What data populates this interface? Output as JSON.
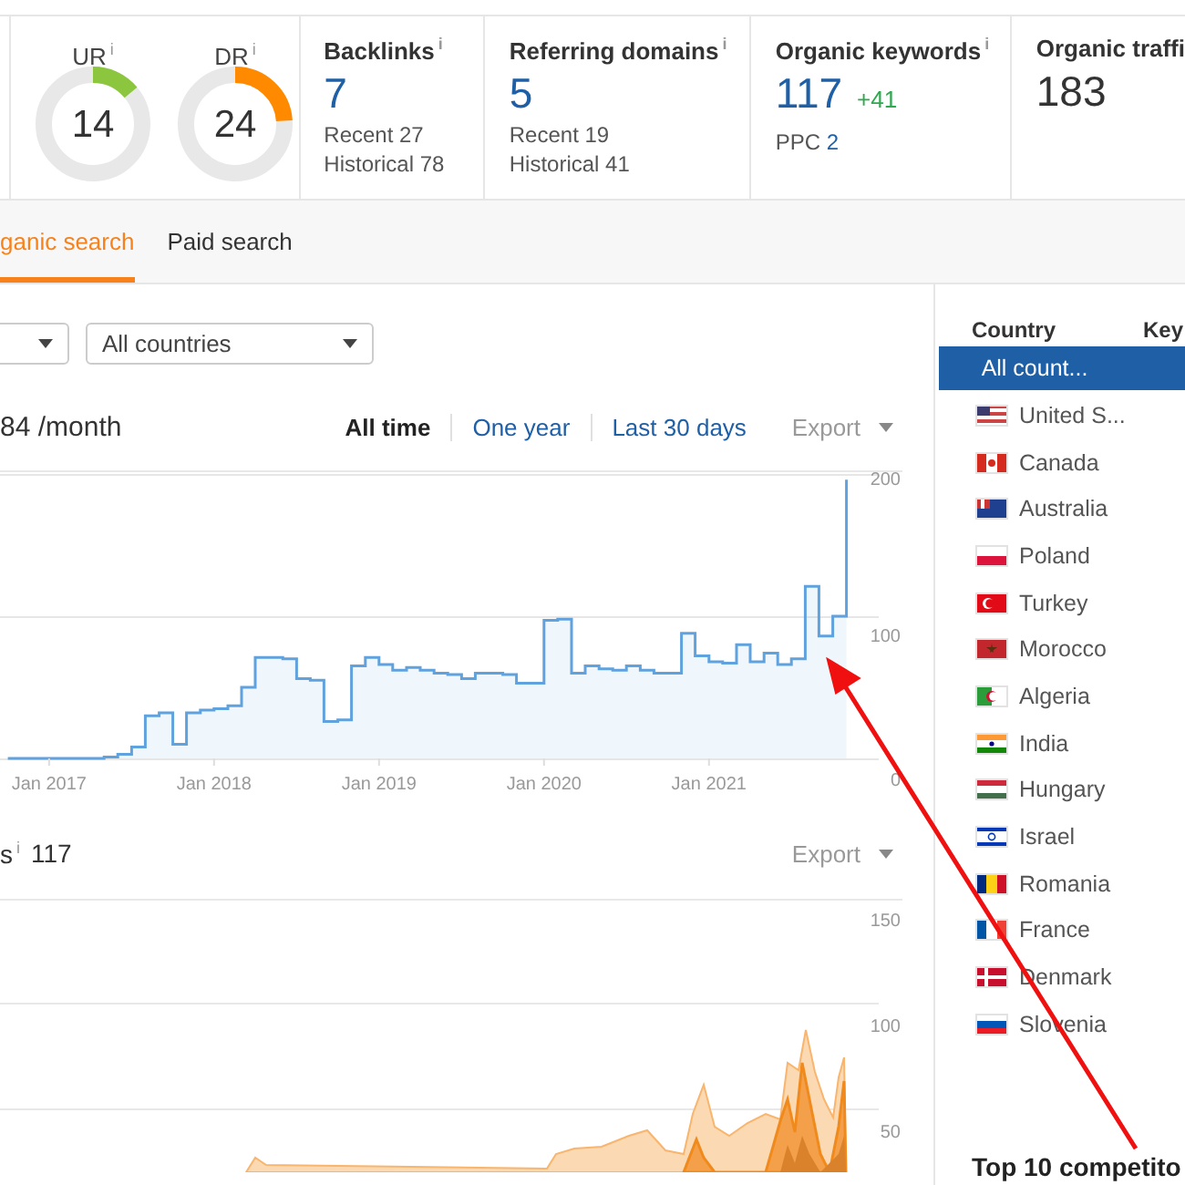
{
  "gauges": [
    {
      "label": "UR",
      "info": "i",
      "value": "14",
      "level": 0.14,
      "color": "#8cc63f"
    },
    {
      "label": "DR",
      "info": "i",
      "value": "24",
      "level": 0.24,
      "color": "#ff8a00"
    }
  ],
  "metrics": [
    {
      "label": "Backlinks",
      "info": "i",
      "value": "7",
      "kind": "link",
      "lines": [
        {
          "kind": "plain",
          "text": "Recent 27"
        },
        {
          "kind": "plain",
          "text": "Historical 78"
        }
      ]
    },
    {
      "label": "Referring domains",
      "info": "i",
      "value": "5",
      "kind": "link",
      "lines": [
        {
          "kind": "plain",
          "text": "Recent 19"
        },
        {
          "kind": "plain",
          "text": "Historical 41"
        }
      ]
    },
    {
      "label": "Organic keywords",
      "info": "i",
      "value": "117",
      "kind": "link",
      "change": "+41",
      "lines": [
        {
          "kind": "link",
          "label": "PPC",
          "value": "2"
        }
      ]
    },
    {
      "label": "Organic traffi",
      "value": "183",
      "kind": "plain"
    }
  ],
  "tabs": [
    {
      "label": "ganic search",
      "selected": true
    },
    {
      "label": "Paid search",
      "selected": false
    }
  ],
  "filters": [
    {
      "kind": "dropdown"
    },
    {
      "kind": "dropdown",
      "value": "All countries"
    }
  ],
  "traffic_summary": "84 /month",
  "time_ranges": [
    {
      "label": "All time",
      "selected": true
    },
    {
      "label": "One year",
      "selected": false
    },
    {
      "label": "Last 30 days",
      "selected": false
    }
  ],
  "traffic_chart": {
    "export": "Export",
    "chart_data": {
      "type": "area",
      "ylim": [
        0,
        200
      ],
      "yticks": [
        0,
        100,
        200
      ],
      "categories": [
        null,
        null,
        null,
        "Jan 2017",
        null,
        null,
        null,
        null,
        null,
        null,
        null,
        null,
        null,
        null,
        null,
        "Jan 2018",
        null,
        null,
        null,
        null,
        null,
        null,
        null,
        null,
        null,
        null,
        null,
        "Jan 2019",
        null,
        null,
        null,
        null,
        null,
        null,
        null,
        null,
        null,
        null,
        null,
        "Jan 2020",
        null,
        null,
        null,
        null,
        null,
        null,
        null,
        null,
        null,
        null,
        null,
        "Jan 2021",
        null,
        null,
        null,
        null,
        null,
        null,
        null,
        null,
        null,
        null
      ],
      "series": [
        {
          "color": "#5fa2dd",
          "values": [
            0,
            0,
            0,
            0,
            0,
            0,
            0,
            1,
            3,
            8,
            30,
            32,
            10,
            32,
            34,
            35,
            37,
            50,
            71,
            71,
            70,
            56,
            55,
            26,
            27,
            65,
            71,
            66,
            62,
            64,
            62,
            60,
            59,
            56,
            60,
            60,
            59,
            53,
            53,
            97,
            98,
            60,
            65,
            63,
            62,
            65,
            62,
            60,
            60,
            88,
            72,
            68,
            67,
            80,
            68,
            74,
            66,
            70,
            121,
            86,
            100,
            196
          ]
        }
      ]
    }
  },
  "keywords_chart": {
    "title": "s",
    "info": "i",
    "count": "117",
    "export": "Export",
    "y_axis_labels": [
      "150",
      "100",
      "50"
    ]
  },
  "countries": {
    "columns": [
      "Country",
      "Key"
    ],
    "rows": [
      {
        "name": "All count...",
        "kind": "all",
        "selected": true
      },
      {
        "name": "United S...",
        "kind": "us",
        "selected": false
      },
      {
        "name": "Canada",
        "kind": "ca",
        "selected": false
      },
      {
        "name": "Australia",
        "kind": "au",
        "selected": false
      },
      {
        "name": "Poland",
        "kind": "pl",
        "selected": false
      },
      {
        "name": "Turkey",
        "kind": "tr",
        "selected": false
      },
      {
        "name": "Morocco",
        "kind": "ma",
        "selected": false
      },
      {
        "name": "Algeria",
        "kind": "dz",
        "selected": false
      },
      {
        "name": "India",
        "kind": "in",
        "selected": false
      },
      {
        "name": "Hungary",
        "kind": "hu",
        "selected": false
      },
      {
        "name": "Israel",
        "kind": "il",
        "selected": false
      },
      {
        "name": "Romania",
        "kind": "ro",
        "selected": false
      },
      {
        "name": "France",
        "kind": "fr",
        "selected": false
      },
      {
        "name": "Denmark",
        "kind": "dk",
        "selected": false
      },
      {
        "name": "Slovenia",
        "kind": "si",
        "selected": false
      }
    ]
  },
  "competitors_title": "Top 10 competito"
}
